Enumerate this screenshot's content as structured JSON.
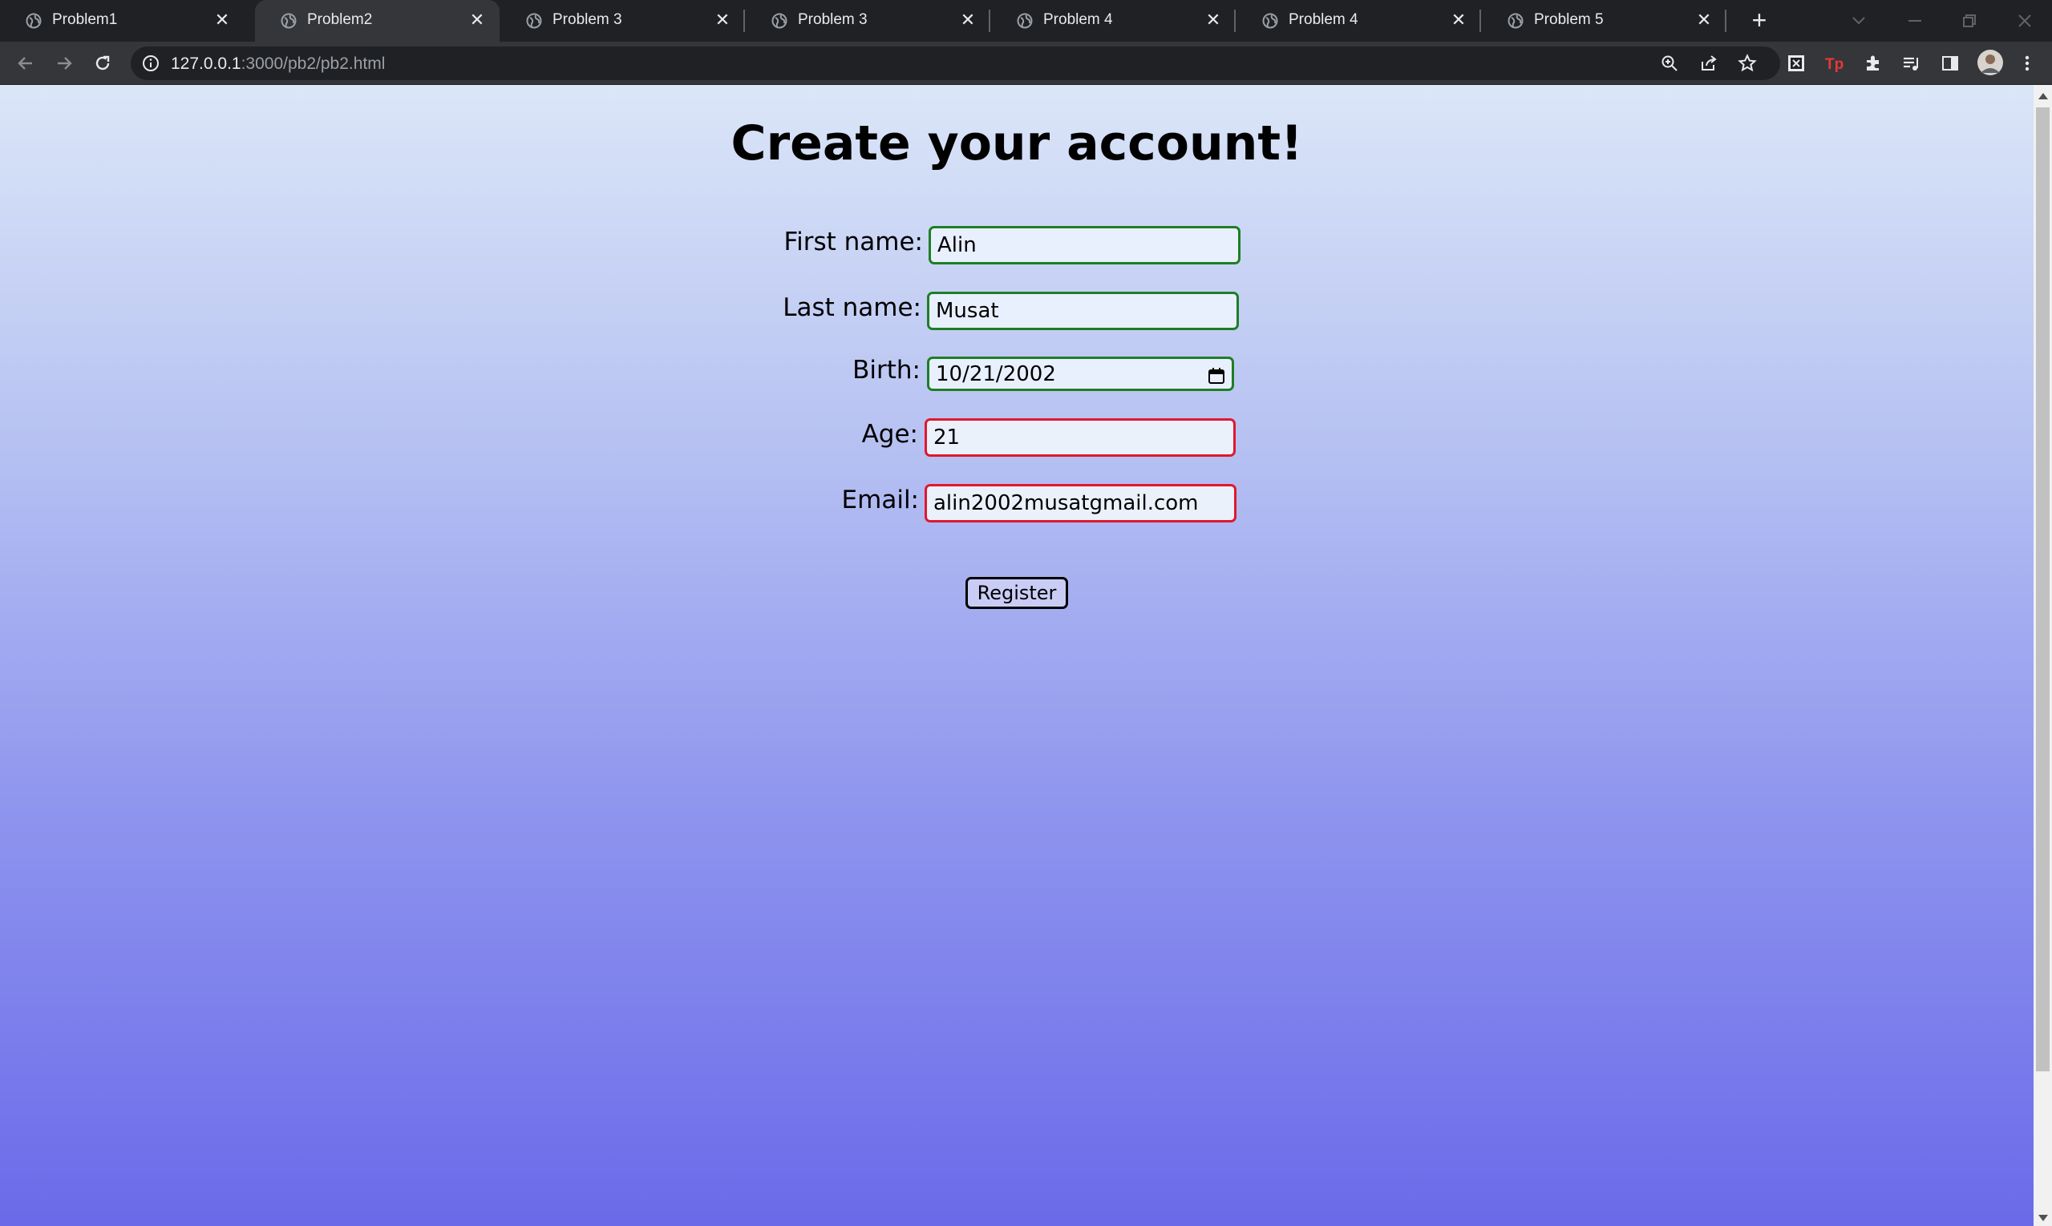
{
  "browser": {
    "tabs": [
      {
        "title": "Problem1",
        "active": false
      },
      {
        "title": "Problem2",
        "active": true
      },
      {
        "title": "Problem 3",
        "active": false
      },
      {
        "title": "Problem 3",
        "active": false
      },
      {
        "title": "Problem 4",
        "active": false
      },
      {
        "title": "Problem 4",
        "active": false
      },
      {
        "title": "Problem 5",
        "active": false
      }
    ],
    "url_host": "127.0.0.1",
    "url_rest": ":3000/pb2/pb2.html",
    "icons": [
      "back-icon",
      "forward-icon",
      "reload-icon",
      "info-icon",
      "zoom-icon",
      "share-icon",
      "star-icon",
      "extension-icon",
      "reading-list-icon",
      "side-panel-icon",
      "avatar",
      "menu-icon"
    ],
    "colors": {
      "tabstrip_bg": "#202124",
      "toolbar_bg": "#35363a",
      "valid_border": "#1e7e24",
      "invalid_border": "#e0182d"
    }
  },
  "page": {
    "heading": "Create your account!",
    "fields": {
      "first_name": {
        "label": "First name:",
        "value": "Alin",
        "state": "valid"
      },
      "last_name": {
        "label": "Last name:",
        "value": "Musat",
        "state": "valid"
      },
      "birth": {
        "label": "Birth:",
        "value": "10/21/2002",
        "state": "valid"
      },
      "age": {
        "label": "Age:",
        "value": "21",
        "state": "invalid"
      },
      "email": {
        "label": "Email:",
        "value": "alin2002musatgmail.com",
        "state": "invalid"
      }
    },
    "register_label": "Register"
  }
}
